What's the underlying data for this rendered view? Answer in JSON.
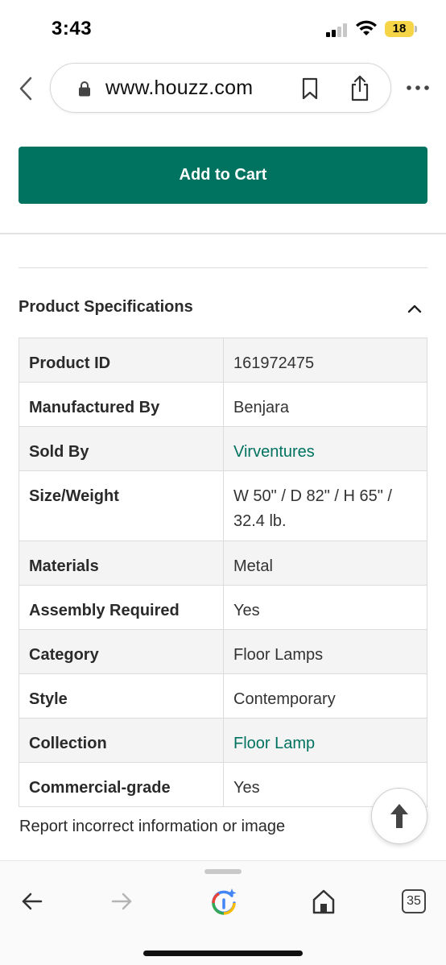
{
  "status_bar": {
    "time": "3:43",
    "battery": "18"
  },
  "browser": {
    "url": "www.houzz.com",
    "tab_count": "35"
  },
  "actions": {
    "add_to_cart": "Add to Cart"
  },
  "specs": {
    "title": "Product Specifications",
    "rows": [
      {
        "label": "Product ID",
        "value": "161972475"
      },
      {
        "label": "Manufactured By",
        "value": "Benjara"
      },
      {
        "label": "Sold By",
        "value": "Virventures"
      },
      {
        "label": "Size/Weight",
        "value": "W 50\" / D 82\" / H 65\" / 32.4 lb."
      },
      {
        "label": "Materials",
        "value": "Metal"
      },
      {
        "label": "Assembly Required",
        "value": "Yes"
      },
      {
        "label": "Category",
        "value": "Floor Lamps"
      },
      {
        "label": "Style",
        "value": "Contemporary"
      },
      {
        "label": "Collection",
        "value": "Floor Lamp"
      },
      {
        "label": "Commercial-grade",
        "value": "Yes"
      }
    ]
  },
  "report_link": "Report incorrect information or image",
  "colors": {
    "brand": "#007260",
    "battery": "#f5d547"
  },
  "icons": [
    "back-chevron-icon",
    "lock-icon",
    "bookmark-icon",
    "share-icon",
    "more-icon",
    "chevron-up-icon",
    "arrow-up-icon",
    "arrow-left-icon",
    "arrow-right-icon",
    "google-lens-icon",
    "home-icon",
    "tabs-icon"
  ]
}
